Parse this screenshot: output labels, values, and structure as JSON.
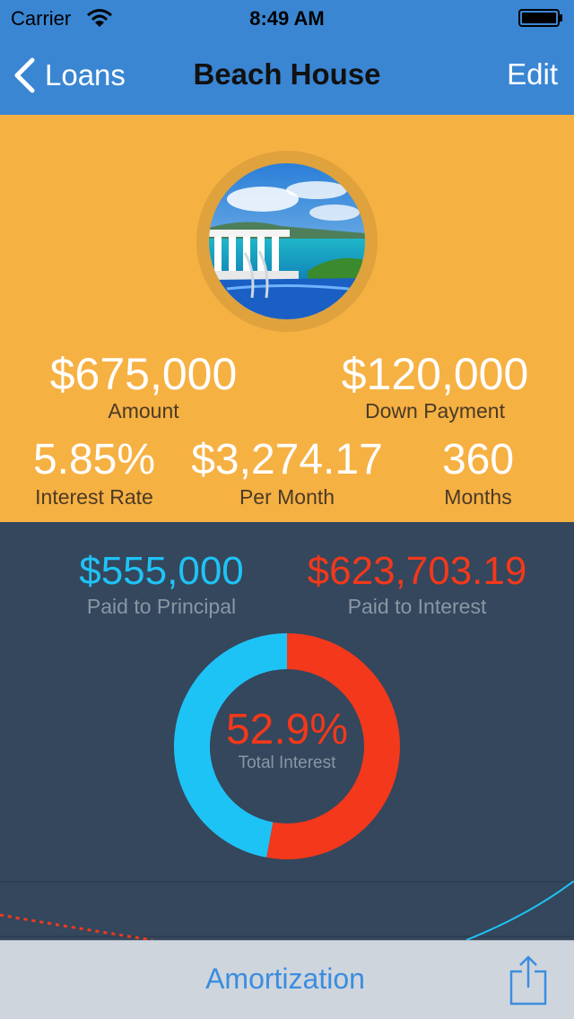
{
  "status": {
    "carrier": "Carrier",
    "time": "8:49 AM"
  },
  "nav": {
    "back_label": "Loans",
    "title": "Beach House",
    "edit_label": "Edit"
  },
  "summary": {
    "amount": {
      "value": "$675,000",
      "label": "Amount"
    },
    "down_payment": {
      "value": "$120,000",
      "label": "Down Payment"
    },
    "interest_rate": {
      "value": "5.85%",
      "label": "Interest Rate"
    },
    "per_month": {
      "value": "$3,274.17",
      "label": "Per Month"
    },
    "months": {
      "value": "360",
      "label": "Months"
    }
  },
  "breakdown": {
    "principal": {
      "value": "$555,000",
      "label": "Paid to Principal",
      "color": "#1ec3f6"
    },
    "interest": {
      "value": "$623,703.19",
      "label": "Paid to Interest",
      "color": "#f3381b"
    },
    "total_interest_pct": "52.9%",
    "total_interest_label": "Total Interest",
    "interest_fraction": 0.529
  },
  "toolbar": {
    "amortization_label": "Amortization"
  },
  "colors": {
    "nav": "#3a86d3",
    "summary": "#f6b143",
    "panel": "#34475c",
    "accent": "#3a8de0"
  }
}
